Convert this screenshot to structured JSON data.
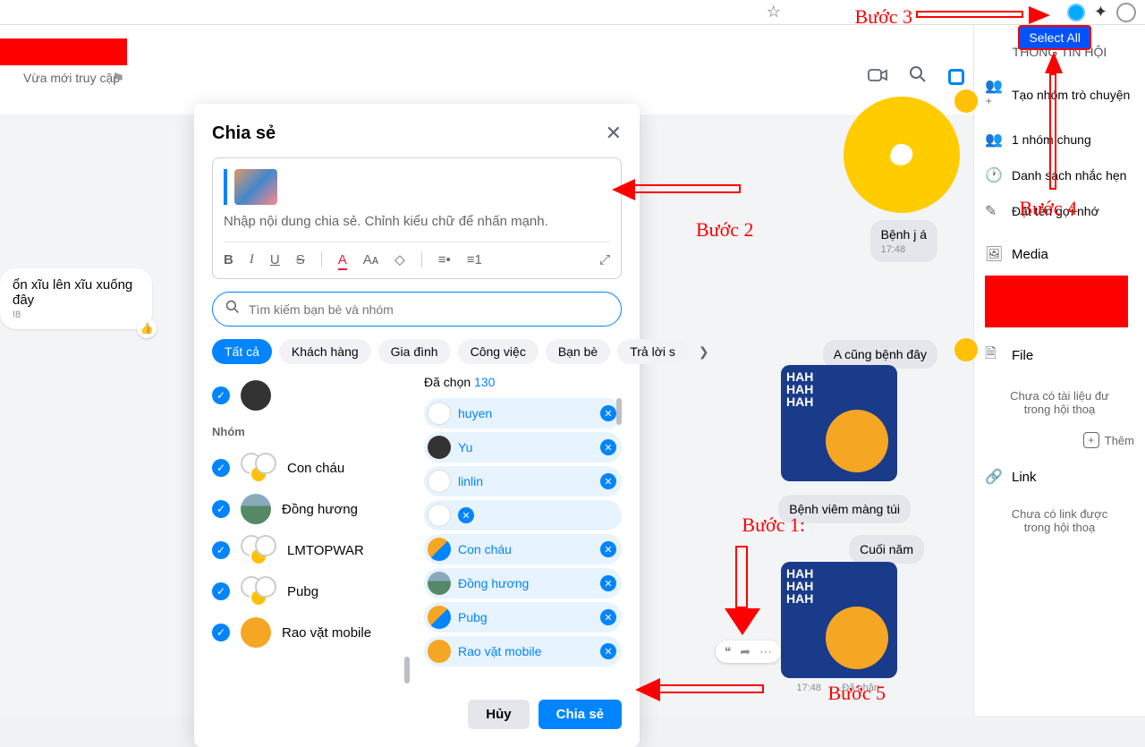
{
  "browser": {
    "star": "☆",
    "puzzle": "✦"
  },
  "select_all": "Select All",
  "header": {
    "subtitle": "Vừa mới truy cập",
    "tag": "⚑"
  },
  "right": {
    "title": "THÔNG TIN HỘI",
    "items": [
      "Tạo nhóm trò chuyện",
      "1 nhóm chung",
      "Danh sách nhắc hẹn",
      "Đặt tên gợi nhớ"
    ],
    "media": "Media",
    "file": "File",
    "file_empty": "Chưa có tài liệu đư\ntrong hội thoạ",
    "add": "Thêm",
    "link": "Link",
    "link_empty": "Chưa có link được\ntrong hội thoạ"
  },
  "chat": {
    "msg_left": "ổn xĩu lên xĩu xuống đây",
    "msg_left_time": "!8",
    "benh": "Bệnh j á",
    "benh_time": "17:48",
    "acung": "A cũng bệnh đây",
    "viem": "Bệnh viêm màng túi",
    "cuoi": "Cuối năm",
    "stamp1": "17:48",
    "stamp2": "Đã nhận"
  },
  "modal": {
    "title": "Chia sẻ",
    "placeholder": "Nhập nội dung chia sẻ. Chỉnh kiểu chữ để nhấn mạnh.",
    "search_ph": "Tìm kiếm bạn bè và nhóm",
    "chips": [
      "Tất cả",
      "Khách hàng",
      "Gia đình",
      "Công việc",
      "Bạn bè",
      "Trả lời s"
    ],
    "group_label": "Nhóm",
    "contacts": [
      "Con cháu",
      "Đồng hương",
      "LMTOPWAR",
      "Pubg",
      "Rao vặt mobile"
    ],
    "sel_label": "Đã chọn",
    "sel_count": "130",
    "selected": [
      "huyen",
      "Yu",
      "linlin",
      "Con cháu",
      "Đồng hương",
      "Pubg",
      "Rao vặt mobile"
    ],
    "cancel": "Hủy",
    "share": "Chia sẻ"
  },
  "ann": {
    "b1": "Bước 1:",
    "b2": "Bước 2",
    "b3": "Bước 3",
    "b4": "Bước 4",
    "b5": "Bước 5"
  }
}
